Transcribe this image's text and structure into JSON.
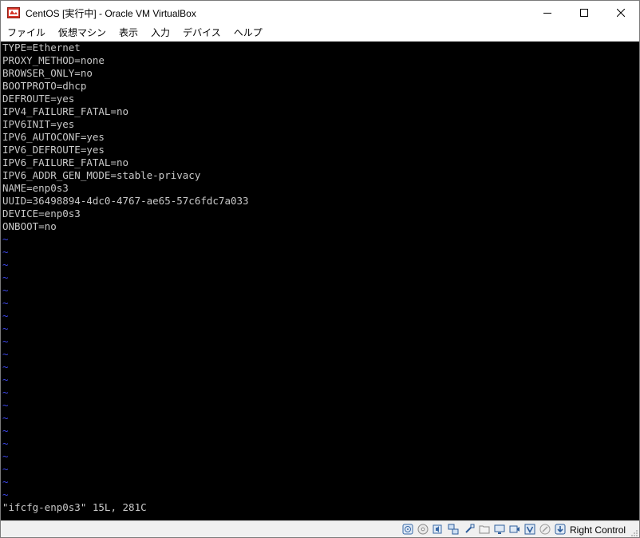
{
  "window": {
    "title": "CentOS [実行中] - Oracle VM VirtualBox",
    "app_icon": "virtualbox-icon",
    "controls": {
      "minimize": "─",
      "maximize": "☐",
      "close": "✕"
    }
  },
  "menu": {
    "items": [
      {
        "label": "ファイル"
      },
      {
        "label": "仮想マシン"
      },
      {
        "label": "表示"
      },
      {
        "label": "入力"
      },
      {
        "label": "デバイス"
      },
      {
        "label": "ヘルプ"
      }
    ]
  },
  "terminal": {
    "lines": [
      "TYPE=Ethernet",
      "PROXY_METHOD=none",
      "BROWSER_ONLY=no",
      "BOOTPROTO=dhcp",
      "DEFROUTE=yes",
      "IPV4_FAILURE_FATAL=no",
      "IPV6INIT=yes",
      "IPV6_AUTOCONF=yes",
      "IPV6_DEFROUTE=yes",
      "IPV6_FAILURE_FATAL=no",
      "IPV6_ADDR_GEN_MODE=stable-privacy",
      "NAME=enp0s3",
      "UUID=36498894-4dc0-4767-ae65-57c6fdc7a033",
      "DEVICE=enp0s3",
      "ONBOOT=no"
    ],
    "tilde_char": "~",
    "tilde_count": 21,
    "status_line": "\"ifcfg-enp0s3\" 15L, 281C",
    "colors": {
      "background": "#000000",
      "text": "#c8c8c8",
      "tilde": "#3c46e6"
    }
  },
  "statusbar": {
    "icons": [
      "hard-disk-icon",
      "optical-drive-icon",
      "audio-icon",
      "network-icon",
      "usb-icon",
      "shared-folders-icon",
      "display-icon",
      "recording-icon",
      "virtualization-icon",
      "mouse-integration-icon",
      "keyboard-capture-icon"
    ],
    "host_key": "Right Control"
  }
}
